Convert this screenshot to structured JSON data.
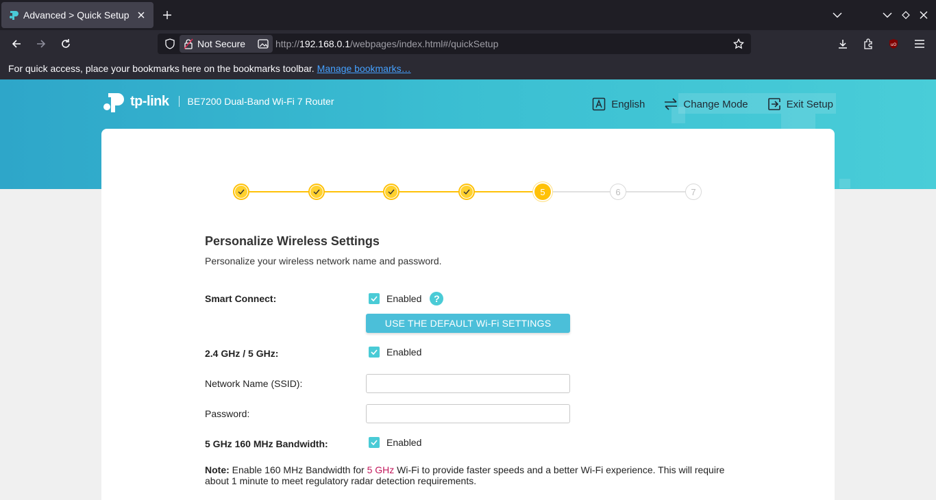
{
  "browser": {
    "tab_title": "Advanced > Quick Setup",
    "security_label": "Not Secure",
    "url_prefix": "http://",
    "url_host": "192.168.0.1",
    "url_path": "/webpages/index.html#/quickSetup",
    "bookmarks_message": "For quick access, place your bookmarks here on the bookmarks toolbar.",
    "manage_bookmarks": "Manage bookmarks…"
  },
  "header": {
    "logo_text": "tp-link",
    "model": "BE7200 Dual-Band Wi-Fi 7 Router",
    "language": "English",
    "change_mode": "Change Mode",
    "exit_setup": "Exit Setup"
  },
  "stepper": {
    "steps": [
      {
        "label": "1",
        "state": "done"
      },
      {
        "label": "2",
        "state": "done"
      },
      {
        "label": "3",
        "state": "done"
      },
      {
        "label": "4",
        "state": "done"
      },
      {
        "label": "5",
        "state": "current"
      },
      {
        "label": "6",
        "state": "todo"
      },
      {
        "label": "7",
        "state": "todo"
      }
    ]
  },
  "form": {
    "title": "Personalize Wireless Settings",
    "subtitle": "Personalize your wireless network name and password.",
    "smart_connect_label": "Smart Connect:",
    "smart_connect_value": "Enabled",
    "default_button": "USE THE DEFAULT Wi-Fi SETTINGS",
    "band_label": "2.4 GHz / 5 GHz:",
    "band_value": "Enabled",
    "ssid_label": "Network Name (SSID):",
    "ssid_value": "",
    "password_label": "Password:",
    "password_value": "",
    "bandwidth_label": "5 GHz 160 MHz Bandwidth:",
    "bandwidth_value": "Enabled",
    "note_label": "Note:",
    "note_text_1": " Enable 160 MHz Bandwidth for ",
    "note_highlight": "5 GHz",
    "note_text_2": " Wi-Fi to provide faster speeds and a better Wi-Fi experience. This will require about 1 minute to meet regulatory radar detection requirements."
  },
  "colors": {
    "accent": "#4acbd6",
    "stepper_active": "#ffc107",
    "banner": "#3bbfd2"
  }
}
